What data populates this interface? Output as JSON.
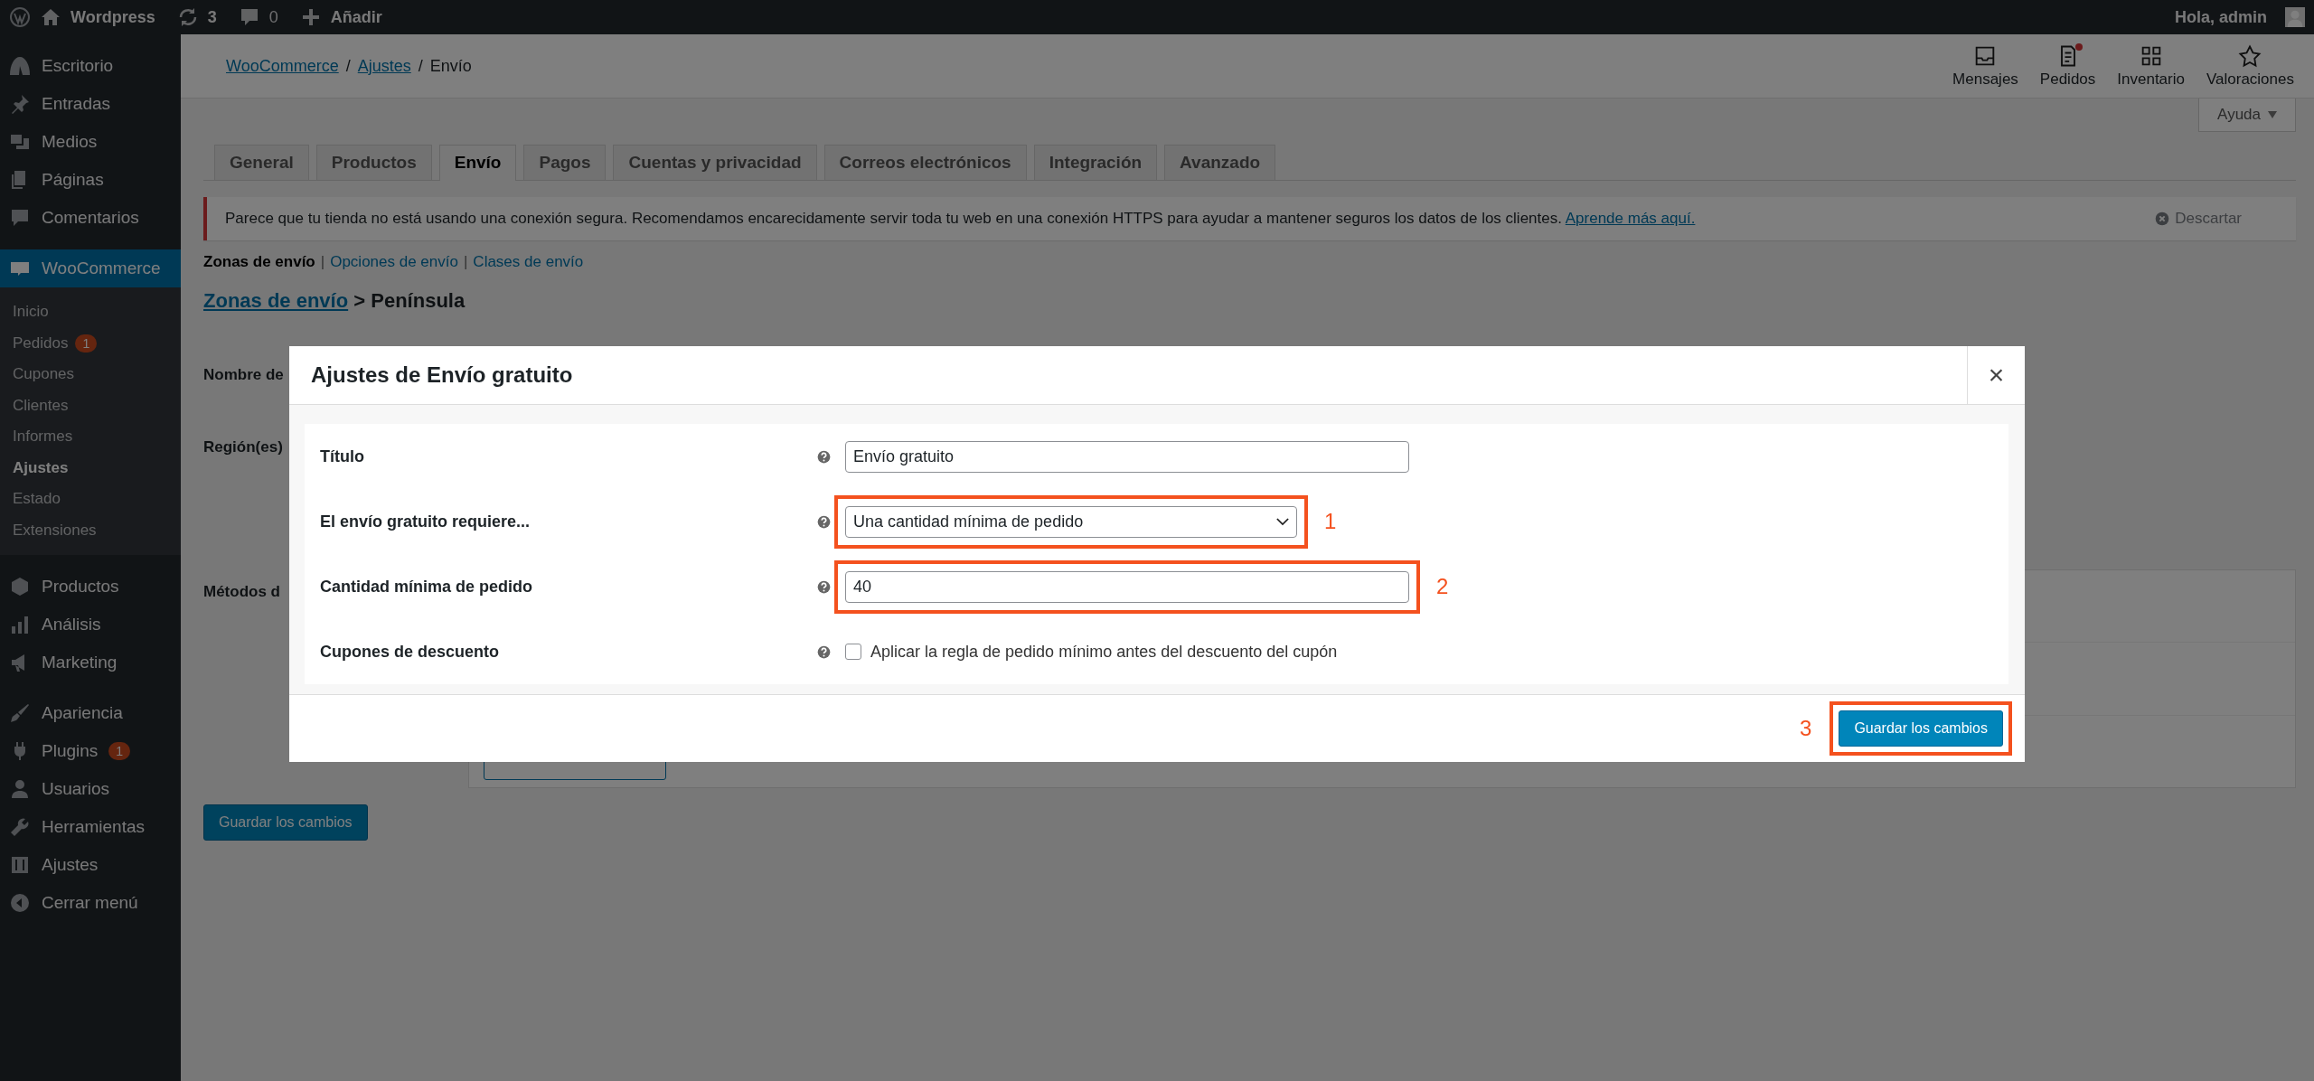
{
  "admin_bar": {
    "site": "Wordpress",
    "updates": "3",
    "comments": "0",
    "new": "Añadir",
    "greeting": "Hola, admin"
  },
  "sidebar": {
    "items": [
      {
        "label": "Escritorio",
        "selected": false
      },
      {
        "label": "Entradas",
        "selected": false
      },
      {
        "label": "Medios",
        "selected": false
      },
      {
        "label": "Páginas",
        "selected": false
      },
      {
        "label": "Comentarios",
        "selected": false
      },
      {
        "label": "WooCommerce",
        "selected": true,
        "children": [
          {
            "label": "Inicio",
            "selected": false
          },
          {
            "label": "Pedidos",
            "selected": false,
            "badge": "1"
          },
          {
            "label": "Cupones",
            "selected": false
          },
          {
            "label": "Clientes",
            "selected": false
          },
          {
            "label": "Informes",
            "selected": false
          },
          {
            "label": "Ajustes",
            "selected": true
          },
          {
            "label": "Estado",
            "selected": false
          },
          {
            "label": "Extensiones",
            "selected": false
          }
        ]
      },
      {
        "label": "Productos",
        "selected": false
      },
      {
        "label": "Análisis",
        "selected": false
      },
      {
        "label": "Marketing",
        "selected": false
      },
      {
        "label": "Apariencia",
        "selected": false
      },
      {
        "label": "Plugins",
        "selected": false,
        "badge": "1"
      },
      {
        "label": "Usuarios",
        "selected": false
      },
      {
        "label": "Herramientas",
        "selected": false
      },
      {
        "label": "Ajustes",
        "selected": false
      },
      {
        "label": "Cerrar menú",
        "selected": false
      }
    ]
  },
  "header": {
    "breadcrumb": [
      {
        "label": "WooCommerce",
        "link": true
      },
      {
        "label": "Ajustes",
        "link": true
      },
      {
        "label": "Envío",
        "link": false
      }
    ],
    "separator": "/",
    "activity": [
      {
        "label": "Mensajes",
        "dot": false
      },
      {
        "label": "Pedidos",
        "dot": true
      },
      {
        "label": "Inventario",
        "dot": false
      },
      {
        "label": "Valoraciones",
        "dot": false
      }
    ]
  },
  "help_button": "Ayuda",
  "tabs": [
    {
      "label": "General",
      "selected": false
    },
    {
      "label": "Productos",
      "selected": false
    },
    {
      "label": "Envío",
      "selected": true
    },
    {
      "label": "Pagos",
      "selected": false
    },
    {
      "label": "Cuentas y privacidad",
      "selected": false
    },
    {
      "label": "Correos electrónicos",
      "selected": false
    },
    {
      "label": "Integración",
      "selected": false
    },
    {
      "label": "Avanzado",
      "selected": false
    }
  ],
  "notice": {
    "text": "Parece que tu tienda no está usando una conexión segura. Recomendamos encarecidamente servir toda tu web en una conexión HTTPS para ayudar a mantener seguros los datos de los clientes.",
    "link": "Aprende más aquí.",
    "dismiss": "Descartar"
  },
  "subnav": {
    "separator": "|",
    "items": [
      {
        "label": "Zonas de envío",
        "selected": true
      },
      {
        "label": "Opciones de envío",
        "selected": false
      },
      {
        "label": "Clases de envío",
        "selected": false
      }
    ]
  },
  "heading": {
    "link": "Zonas de envío",
    "rest": "> Península"
  },
  "form_labels": [
    "Nombre de",
    "Región(es)",
    "Métodos d"
  ],
  "save_button": "Guardar los cambios",
  "modal": {
    "title": "Ajustes de Envío gratuito",
    "close": "×",
    "rows": [
      {
        "kind": "text",
        "label": "Título",
        "value": "Envío gratuito"
      },
      {
        "kind": "select",
        "label": "El envío gratuito requiere...",
        "value": "Una cantidad mínima de pedido",
        "annotation": "1"
      },
      {
        "kind": "number",
        "label": "Cantidad mínima de pedido",
        "value": "40",
        "annotation": "2"
      },
      {
        "kind": "checkbox",
        "label": "Cupones de descuento",
        "text": "Aplicar la regla de pedido mínimo antes del descuento del cupón",
        "checked": false
      }
    ],
    "save": {
      "label": "Guardar los cambios",
      "annotation": "3"
    }
  }
}
